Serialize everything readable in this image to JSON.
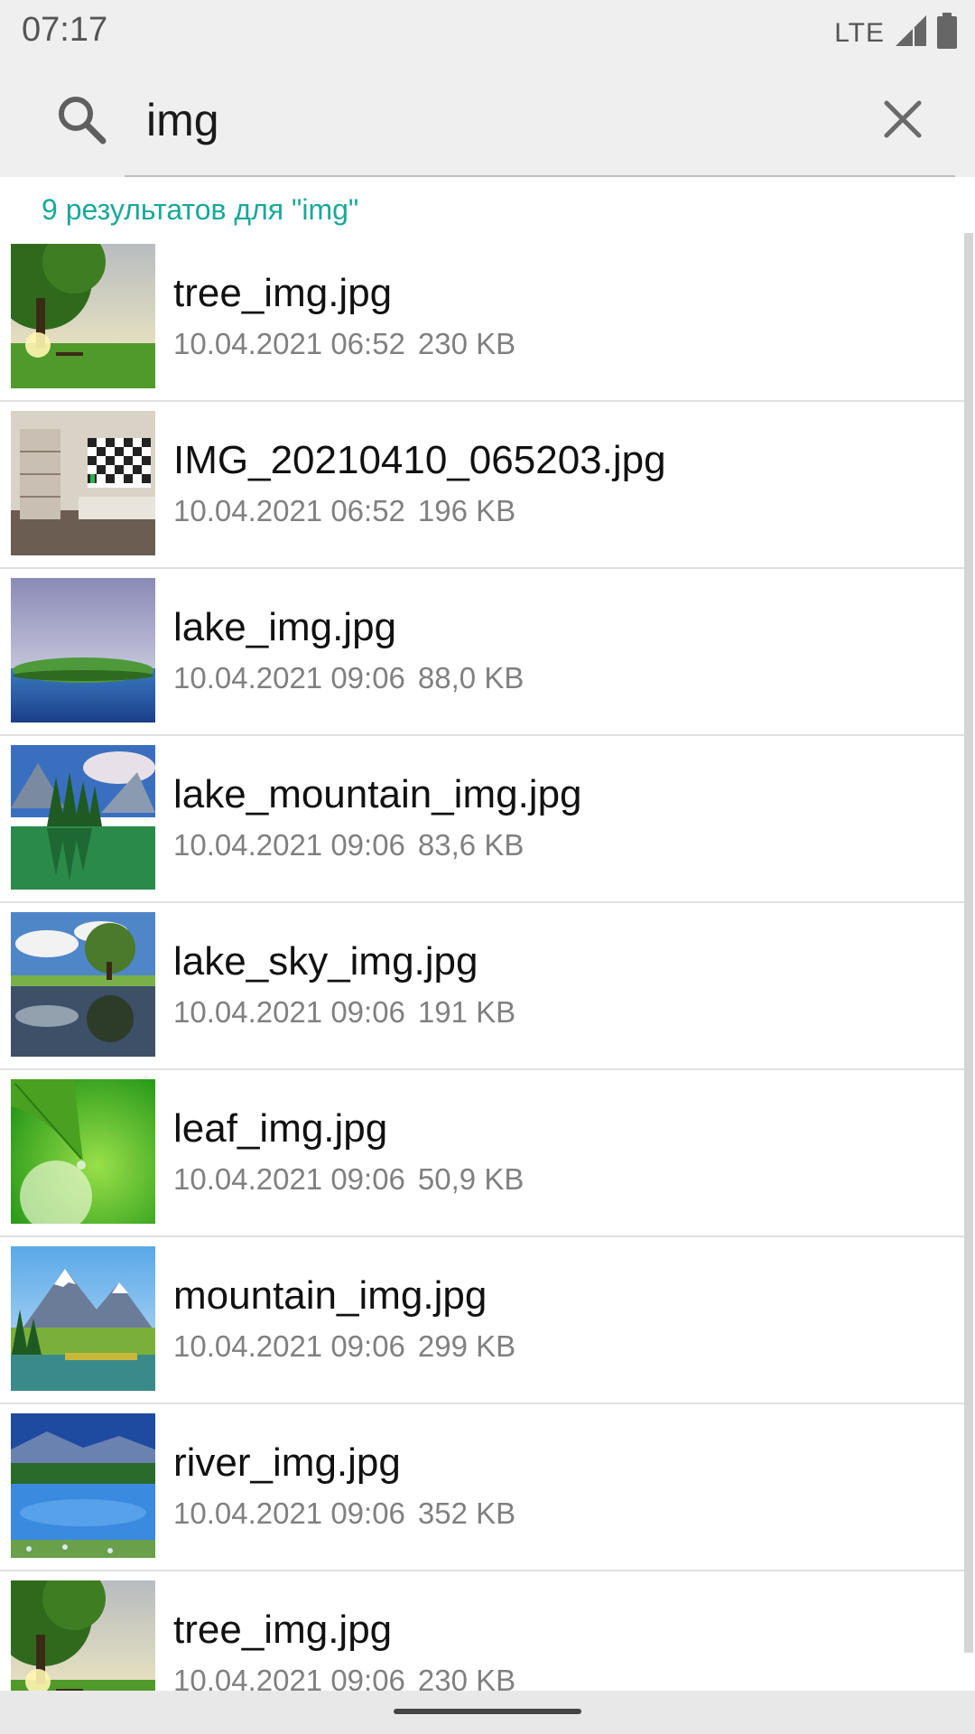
{
  "status_bar": {
    "time": "07:17",
    "network": "LTE"
  },
  "search": {
    "query": "img"
  },
  "results_header": "9 результатов для \"img\"",
  "files": [
    {
      "name": "tree_img.jpg",
      "date": "10.04.2021 06:52",
      "size": "230 KB",
      "thumb": "tree"
    },
    {
      "name": "IMG_20210410_065203.jpg",
      "date": "10.04.2021 06:52",
      "size": "196 KB",
      "thumb": "room"
    },
    {
      "name": "lake_img.jpg",
      "date": "10.04.2021 09:06",
      "size": "88,0 KB",
      "thumb": "lake"
    },
    {
      "name": "lake_mountain_img.jpg",
      "date": "10.04.2021 09:06",
      "size": "83,6 KB",
      "thumb": "lake-mountain"
    },
    {
      "name": "lake_sky_img.jpg",
      "date": "10.04.2021 09:06",
      "size": "191 KB",
      "thumb": "lake-sky"
    },
    {
      "name": "leaf_img.jpg",
      "date": "10.04.2021 09:06",
      "size": "50,9 KB",
      "thumb": "leaf"
    },
    {
      "name": "mountain_img.jpg",
      "date": "10.04.2021 09:06",
      "size": "299 KB",
      "thumb": "mountain"
    },
    {
      "name": "river_img.jpg",
      "date": "10.04.2021 09:06",
      "size": "352 KB",
      "thumb": "river"
    },
    {
      "name": "tree_img.jpg",
      "date": "10.04.2021 09:06",
      "size": "230 KB",
      "thumb": "tree"
    }
  ],
  "colors": {
    "accent": "#1aa89a",
    "meta_text": "#808080",
    "bar_bg": "#efefef"
  }
}
